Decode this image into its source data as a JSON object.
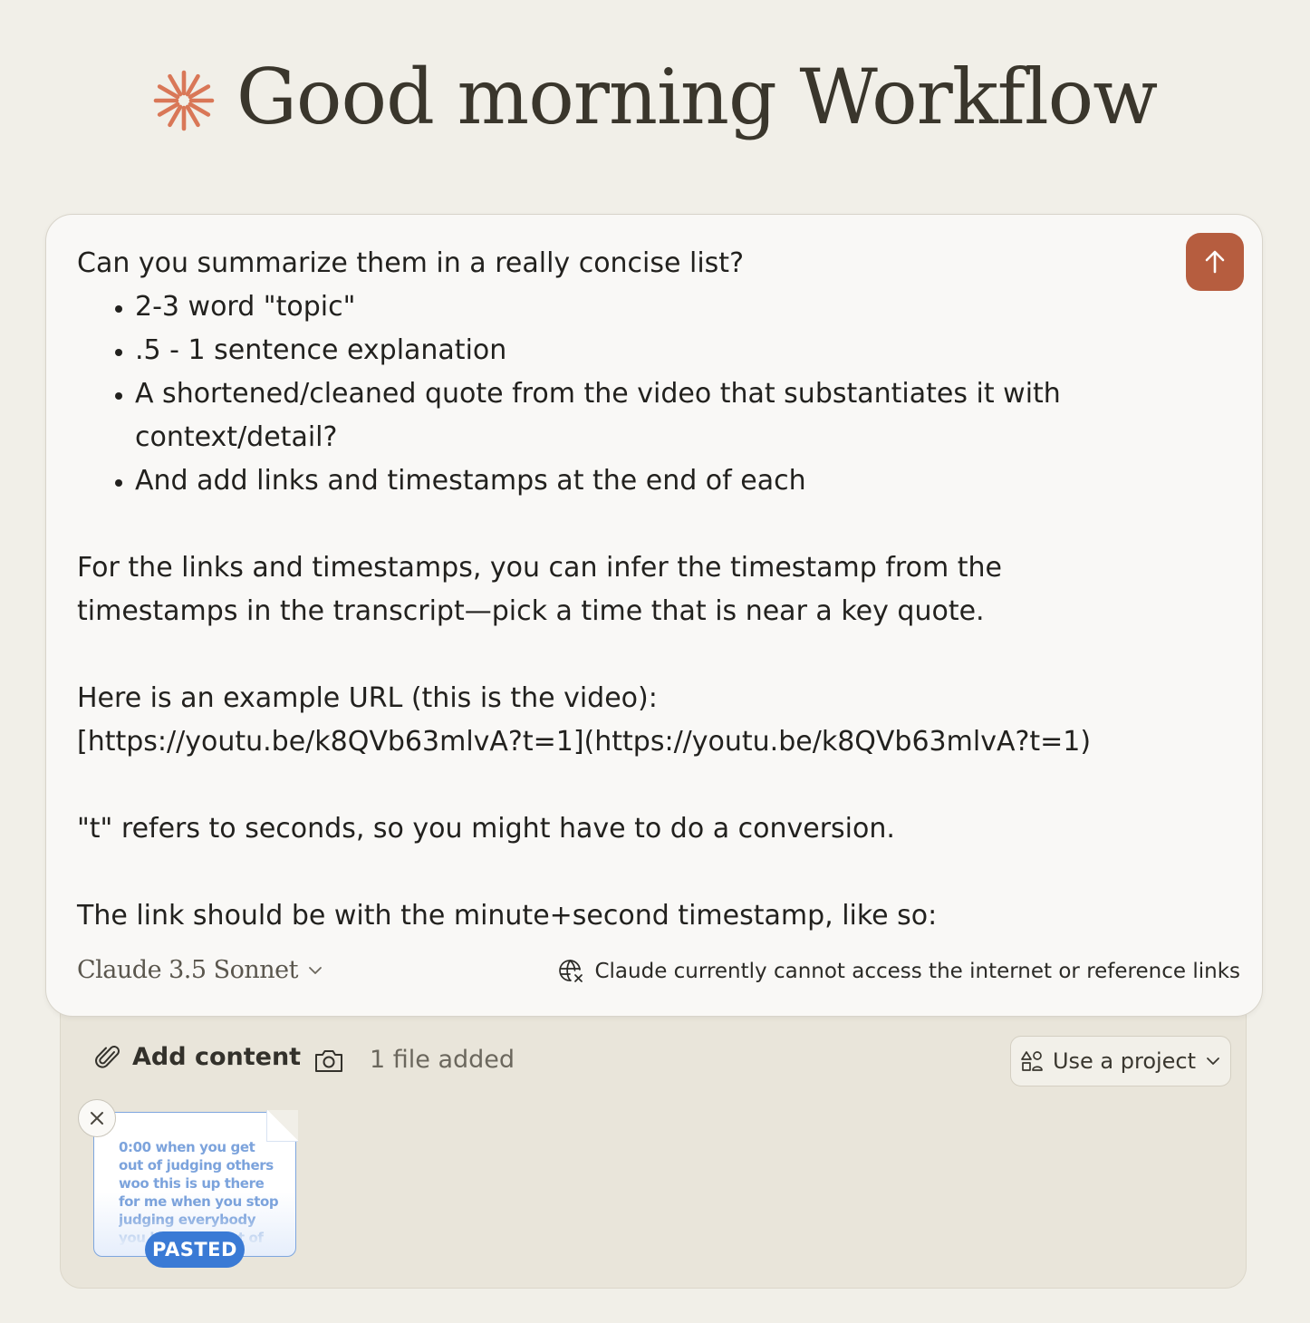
{
  "greeting": {
    "title": "Good morning Workflow",
    "logo_icon": "claude-starburst-icon",
    "logo_color": "#d97757"
  },
  "composer": {
    "message_lines": {
      "intro": "Can you summarize them in a really concise list?",
      "bullets": [
        "2-3 word \"topic\"",
        ".5 - 1 sentence explanation",
        "A shortened/cleaned quote from the video that substantiates it with context/detail?",
        "And add links and timestamps at the end of each"
      ],
      "para1_line1": "For the links and timestamps, you can infer the timestamp from the",
      "para1_line2": "timestamps in the transcript—pick a time that is near a key quote.",
      "para2_line1": "Here is an example URL (this is the video):",
      "para2_line2": "[https://youtu.be/k8QVb63mlvA?t=1](https://youtu.be/k8QVb63mlvA?t=1)",
      "para3": "\"t\" refers to seconds, so you might have to do a conversion.",
      "para4": "The link should be with the minute+second timestamp, like so:"
    },
    "send_icon": "arrow-up-icon",
    "send_color": "#b65d3f",
    "model": {
      "label": "Claude 3.5 Sonnet",
      "icon": "chevron-down-icon"
    },
    "notice": {
      "icon": "globe-offline-icon",
      "text": "Claude currently cannot access the internet or reference links"
    }
  },
  "tray": {
    "add_content_label": "Add content",
    "add_content_icon": "paperclip-icon",
    "camera_icon": "camera-icon",
    "file_count": "1 file added",
    "project_button": {
      "label": "Use a project",
      "icon": "project-shapes-icon",
      "chevron": "chevron-down-icon"
    },
    "attachment": {
      "preview_text": "0:00 when you get out of judging others woo this is up there for me when you stop judging everybody you become a lot of",
      "badge": "PASTED",
      "remove_icon": "close-icon",
      "accent": "#3a7ad5"
    }
  }
}
